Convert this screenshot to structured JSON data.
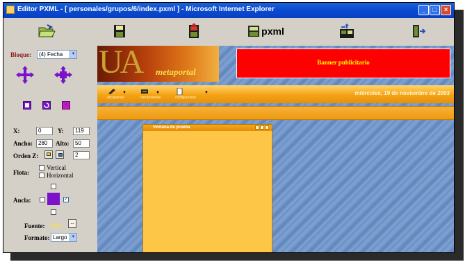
{
  "window": {
    "title": "Editor PXML - [ personales/grupos/6/index.pxml ] - Microsoft Internet Explorer",
    "controls": [
      "minimize",
      "maximize",
      "close"
    ]
  },
  "toolbar": {
    "buttons": [
      {
        "name": "open-folder-icon"
      },
      {
        "name": "save-disk-icon"
      },
      {
        "name": "page-editor-icon"
      },
      {
        "name": "pxml-icon",
        "label": "pxml"
      },
      {
        "name": "blocks-icon"
      },
      {
        "name": "exit-door-icon"
      }
    ]
  },
  "sidebar": {
    "bloque_label": "Bloque:",
    "bloque_value": "(4) Fecha",
    "x_label": "X:",
    "x_value": "0",
    "y_label": "Y:",
    "y_value": "119",
    "ancho_label": "Ancho:",
    "ancho_value": "280",
    "alto_label": "Alto:",
    "alto_value": "50",
    "ordenz_label": "Orden Z:",
    "ordenz_value": "2",
    "flota_label": "Flota:",
    "flota_vertical": "Vertical",
    "flota_horizontal": "Horizontal",
    "ancla_label": "Ancla:",
    "fuente_label": "Fuente:",
    "fuente_sample": "Abc",
    "fuente_button": "...",
    "formato_label": "Formato:",
    "formato_value": "Largo"
  },
  "content": {
    "logo_text": "UA",
    "logo_subtext": "metaportal",
    "banner_text": "Banner publicitario",
    "menu": [
      {
        "label": "escaparate"
      },
      {
        "label": "herramientas"
      },
      {
        "label": "configuración"
      }
    ],
    "date": "miércoles, 19 de noviembre de 2003",
    "floating_window_title": "Ventana de prueba"
  },
  "colors": {
    "title_bar": "#0a4ad1",
    "banner_red": "#ff0000",
    "orange_bar": "#f5a214",
    "window_yellow": "#fdc646",
    "sidebar_gray": "#d4d0c8"
  }
}
